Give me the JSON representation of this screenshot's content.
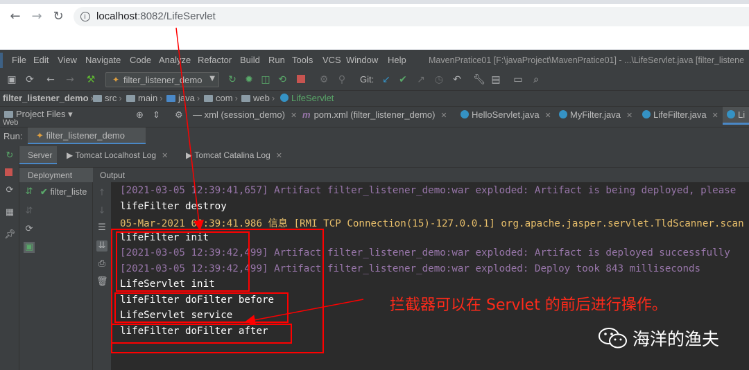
{
  "browser": {
    "url_host": "localhost",
    "url_rest": ":8082/LifeServlet",
    "back_icon": "arrow-left-icon",
    "forward_icon": "arrow-right-icon",
    "reload_icon": "reload-icon"
  },
  "ide": {
    "menu": [
      "File",
      "Edit",
      "View",
      "Navigate",
      "Code",
      "Analyze",
      "Refactor",
      "Build",
      "Run",
      "Tools",
      "VCS",
      "Window",
      "Help"
    ],
    "window_title": "MavenPratice01 [F:\\javaProject\\MavenPratice01] - ...\\LifeServlet.java [filter_listene",
    "run_config": "filter_listener_demo",
    "git_label": "Git:",
    "breadcrumb": [
      "filter_listener_demo",
      "src",
      "main",
      "java",
      "com",
      "web",
      "LifeServlet"
    ],
    "project_files_label": "Project Files",
    "web_label": "Web",
    "editor_tabs": [
      {
        "label": "xml (session_demo)"
      },
      {
        "label": "pom.xml (filter_listener_demo)"
      },
      {
        "label": "HelloServlet.java"
      },
      {
        "label": "MyFilter.java"
      },
      {
        "label": "LifeFilter.java"
      },
      {
        "label": "Li"
      }
    ],
    "run_label": "Run:",
    "run_tab": "filter_listener_demo",
    "sub_tabs": [
      "Server",
      "Tomcat Localhost Log",
      "Tomcat Catalina Log"
    ],
    "deployment_label": "Deployment",
    "output_label": "Output",
    "deploy_item": "filter_liste",
    "console_lines": [
      "[2021-03-05 12:39:41,657] Artifact filter_listener_demo:war exploded: Artifact is being deployed, please",
      "lifeFilter destroy",
      "05-Mar-2021 00:39:41.986 信息 [RMI TCP Connection(15)-127.0.0.1] org.apache.jasper.servlet.TldScanner.scan",
      "lifeFilter init",
      "[2021-03-05 12:39:42,499] Artifact filter_listener_demo:war exploded: Artifact is deployed successfully",
      "[2021-03-05 12:39:42,499] Artifact filter_listener_demo:war exploded: Deploy took 843 milliseconds",
      "LifeServlet init",
      "lifeFilter doFilter before",
      "LifeServlet service",
      "lifeFilter doFilter after"
    ]
  },
  "annotation": "拦截器可以在 Servlet 的前后进行操作。",
  "watermark": "海洋的渔夫",
  "colors": {
    "console_white": "#ffffff",
    "console_purple": "#9876aa",
    "console_orange": "#e8bf6a",
    "annotation_red": "#ff0000"
  }
}
